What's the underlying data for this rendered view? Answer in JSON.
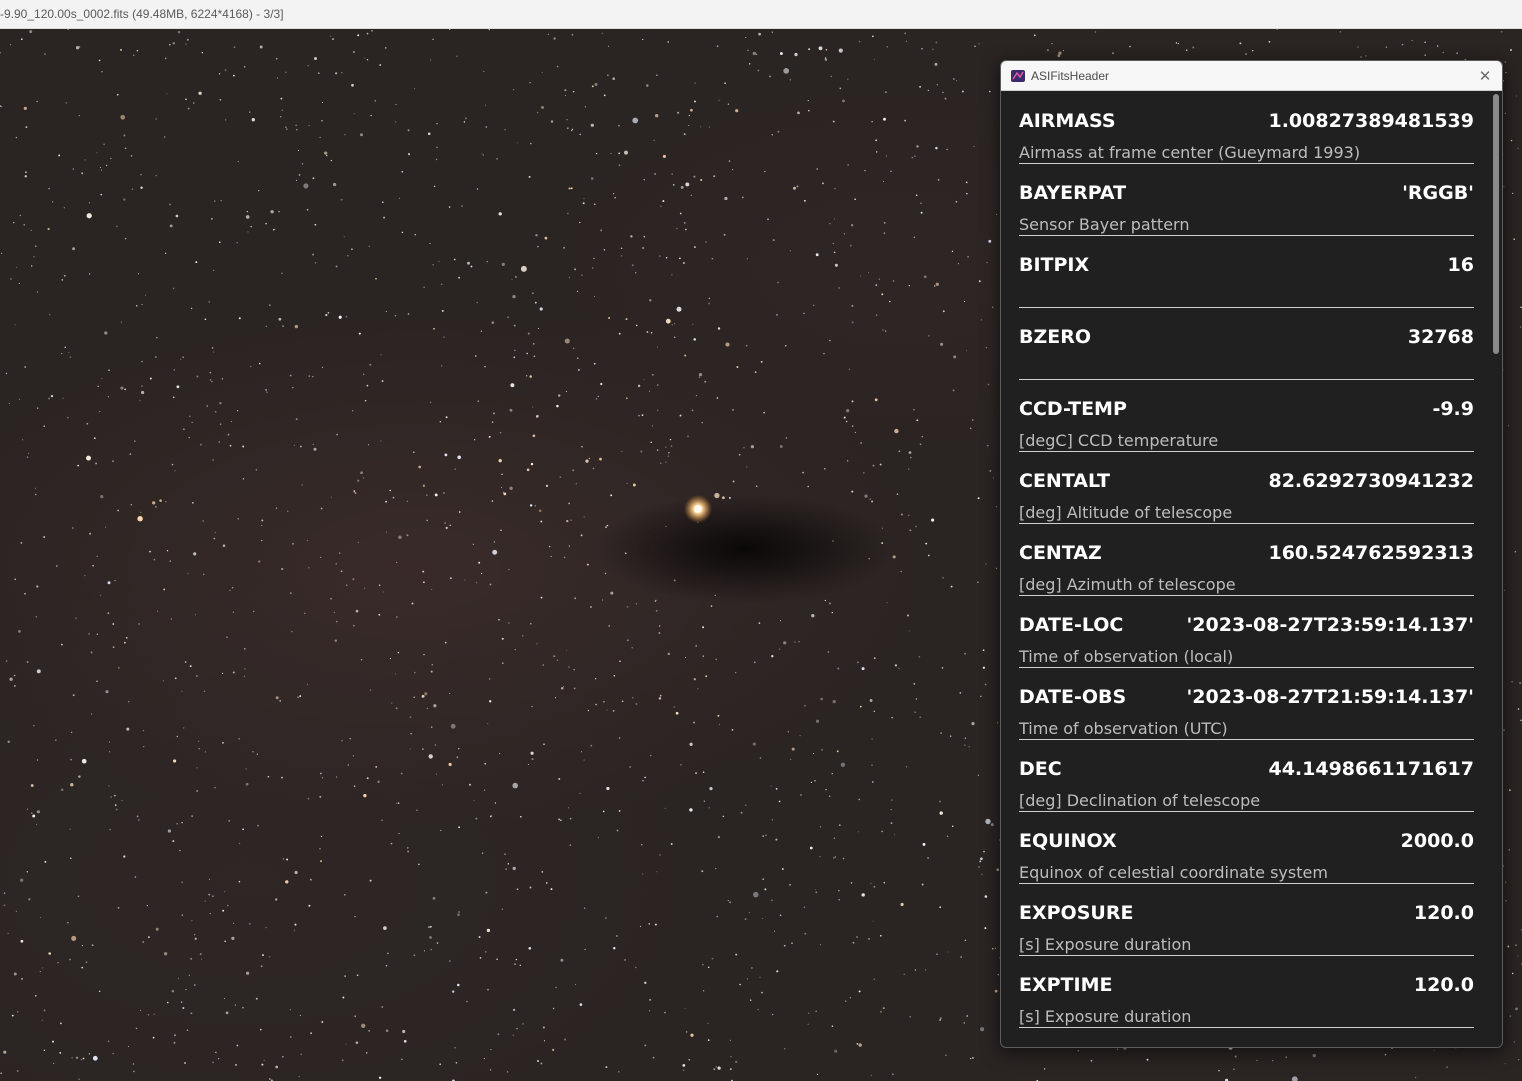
{
  "window": {
    "title": "-9.90_120.00s_0002.fits (49.48MB, 6224*4168) - 3/3]"
  },
  "fits_panel": {
    "title": "ASIFitsHeader",
    "close_icon": "close-icon",
    "entries": [
      {
        "key": "AIRMASS",
        "value": "1.00827389481539",
        "comment": "Airmass at frame center (Gueymard 1993)"
      },
      {
        "key": "BAYERPAT",
        "value": "'RGGB'",
        "comment": "Sensor Bayer pattern"
      },
      {
        "key": "BITPIX",
        "value": "16",
        "comment": ""
      },
      {
        "key": "BZERO",
        "value": "32768",
        "comment": ""
      },
      {
        "key": "CCD-TEMP",
        "value": "-9.9",
        "comment": "[degC] CCD temperature"
      },
      {
        "key": "CENTALT",
        "value": "82.6292730941232",
        "comment": "[deg] Altitude of telescope"
      },
      {
        "key": "CENTAZ",
        "value": "160.524762592313",
        "comment": "[deg] Azimuth of telescope"
      },
      {
        "key": "DATE-LOC",
        "value": "'2023-08-27T23:59:14.137'",
        "comment": "Time of observation (local)"
      },
      {
        "key": "DATE-OBS",
        "value": "'2023-08-27T21:59:14.137'",
        "comment": "Time of observation (UTC)"
      },
      {
        "key": "DEC",
        "value": "44.1498661171617",
        "comment": "[deg] Declination of telescope"
      },
      {
        "key": "EQUINOX",
        "value": "2000.0",
        "comment": "Equinox of celestial coordinate system"
      },
      {
        "key": "EXPOSURE",
        "value": "120.0",
        "comment": "[s] Exposure duration"
      },
      {
        "key": "EXPTIME",
        "value": "120.0",
        "comment": "[s] Exposure duration"
      }
    ]
  },
  "colors": {
    "panel_bg": "#202020",
    "separator": "#cfcfcf",
    "star_field_bg": "#2a2422"
  }
}
